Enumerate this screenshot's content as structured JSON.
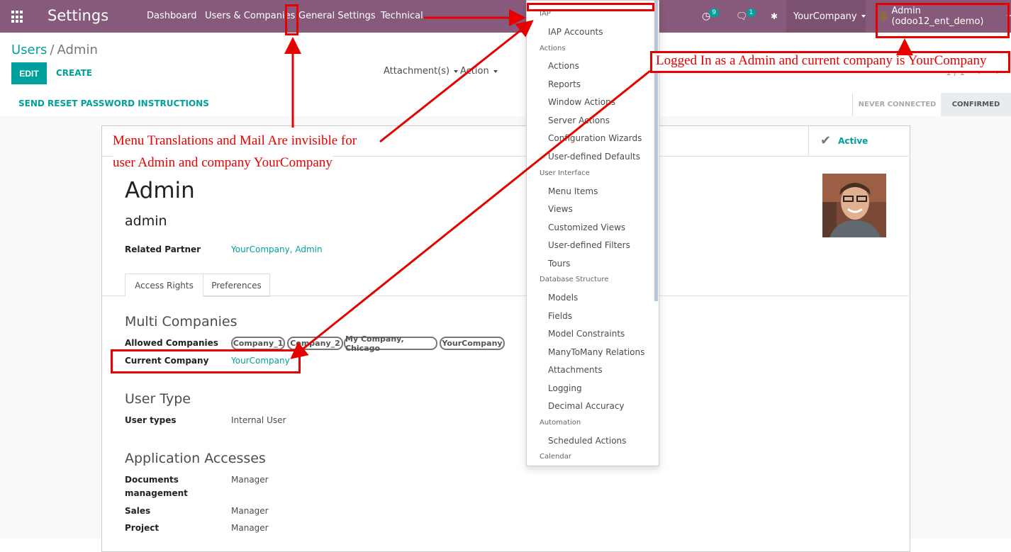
{
  "navbar": {
    "app_title": "Settings",
    "menu": [
      "Dashboard",
      "Users & Companies",
      "General Settings",
      "Technical"
    ],
    "activity_count": "9",
    "message_count": "1",
    "company": "YourCompany",
    "user": "Admin (odoo12_ent_demo)"
  },
  "breadcrumb": {
    "parent": "Users",
    "current": "Admin"
  },
  "buttons": {
    "edit": "EDIT",
    "create": "CREATE"
  },
  "sidebar": {
    "attachments": "Attachment(s)",
    "action": "Action"
  },
  "pager": {
    "value": "1 / 1"
  },
  "statusbar": {
    "send_reset": "SEND RESET PASSWORD INSTRUCTIONS",
    "stages": [
      "NEVER CONNECTED",
      "CONFIRMED"
    ]
  },
  "form": {
    "active_label": "Active",
    "name": "Admin",
    "login": "admin",
    "related_partner_label": "Related Partner",
    "related_partner": "YourCompany, Admin",
    "tabs": [
      "Access Rights",
      "Preferences"
    ],
    "multi_companies_title": "Multi Companies",
    "allowed_companies_label": "Allowed Companies",
    "allowed_companies": [
      "Company_1",
      "Company_2",
      "My Company, Chicago",
      "YourCompany"
    ],
    "current_company_label": "Current Company",
    "current_company": "YourCompany",
    "user_type_title": "User Type",
    "user_types_label": "User types",
    "user_types": "Internal User",
    "app_access_title": "Application Accesses",
    "documents_label_1": "Documents",
    "documents_label_2": "management",
    "documents_value": "Manager",
    "sales_label": "Sales",
    "sales_value": "Manager",
    "project_label": "Project",
    "project_value": "Manager"
  },
  "technical_menu": {
    "sections": [
      {
        "header": "IAP",
        "items": [
          "IAP Accounts"
        ]
      },
      {
        "header": "Actions",
        "items": [
          "Actions",
          "Reports",
          "Window Actions",
          "Server Actions",
          "Configuration Wizards",
          "User-defined Defaults"
        ]
      },
      {
        "header": "User Interface",
        "items": [
          "Menu Items",
          "Views",
          "Customized Views",
          "User-defined Filters",
          "Tours"
        ]
      },
      {
        "header": "Database Structure",
        "items": [
          "Models",
          "Fields",
          "Model Constraints",
          "ManyToMany Relations",
          "Attachments",
          "Logging",
          "Decimal Accuracy"
        ]
      },
      {
        "header": "Automation",
        "items": [
          "Scheduled Actions"
        ]
      },
      {
        "header": "Calendar",
        "items": []
      }
    ]
  },
  "annotations": {
    "note1_line1": "Menu Translations and Mail Are invisible for",
    "note1_line2": "user Admin and company YourCompany",
    "note2": "Logged In as a Admin and current company is YourCompany"
  },
  "colors": {
    "brand": "#875a7b",
    "accent": "#00a09d",
    "annotation": "#e60000"
  }
}
